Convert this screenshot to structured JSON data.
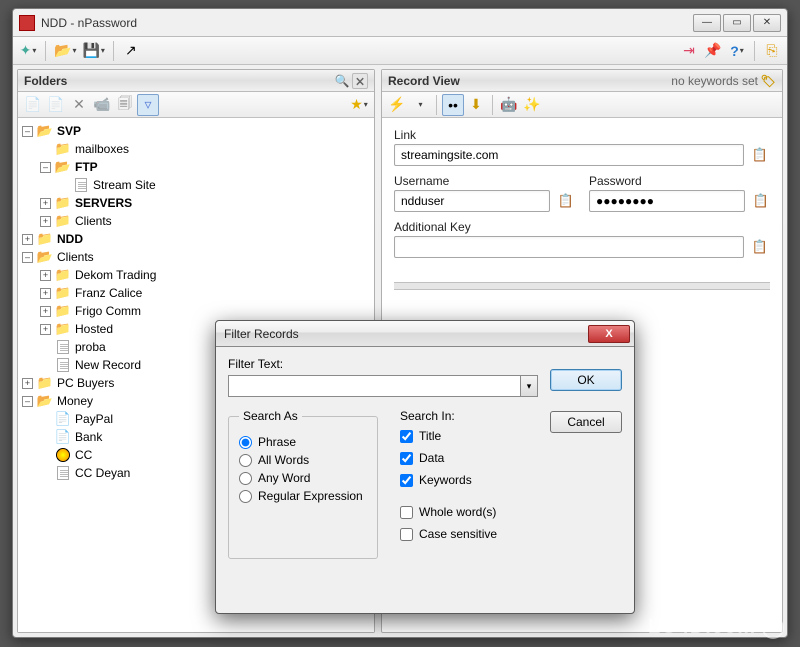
{
  "title": "NDD - nPassword",
  "panels": {
    "folders": {
      "title": "Folders"
    },
    "record": {
      "title": "Record View",
      "keywords_status": "no keywords set"
    }
  },
  "tree": {
    "svp": "SVP",
    "mailboxes": "mailboxes",
    "ftp": "FTP",
    "stream_site": "Stream Site",
    "servers": "SERVERS",
    "clients": "Clients",
    "ndd": "NDD",
    "ndd_clients": "Clients",
    "dekom": "Dekom Trading",
    "franz": "Franz Calice",
    "frigo": "Frigo Comm",
    "hosted": "Hosted",
    "proba": "proba",
    "newrec": "New Record",
    "pcbuyers": "PC Buyers",
    "money": "Money",
    "paypal": "PayPal",
    "bank": "Bank",
    "cc": "CC",
    "ccdeyan": "CC Deyan"
  },
  "form": {
    "link_label": "Link",
    "link_value": "streamingsite.com",
    "user_label": "Username",
    "user_value": "ndduser",
    "pass_label": "Password",
    "pass_value": "●●●●●●●●",
    "addkey_label": "Additional Key",
    "addkey_value": ""
  },
  "dialog": {
    "title": "Filter Records",
    "filter_label": "Filter Text:",
    "filter_value": "",
    "ok": "OK",
    "cancel": "Cancel",
    "search_as": "Search As",
    "phrase": "Phrase",
    "allwords": "All Words",
    "anyword": "Any Word",
    "regex": "Regular Expression",
    "search_in": "Search In:",
    "title_cb": "Title",
    "data_cb": "Data",
    "keywords_cb": "Keywords",
    "whole": "Whole word(s)",
    "case": "Case sensitive"
  },
  "watermark": "LO4D.com"
}
